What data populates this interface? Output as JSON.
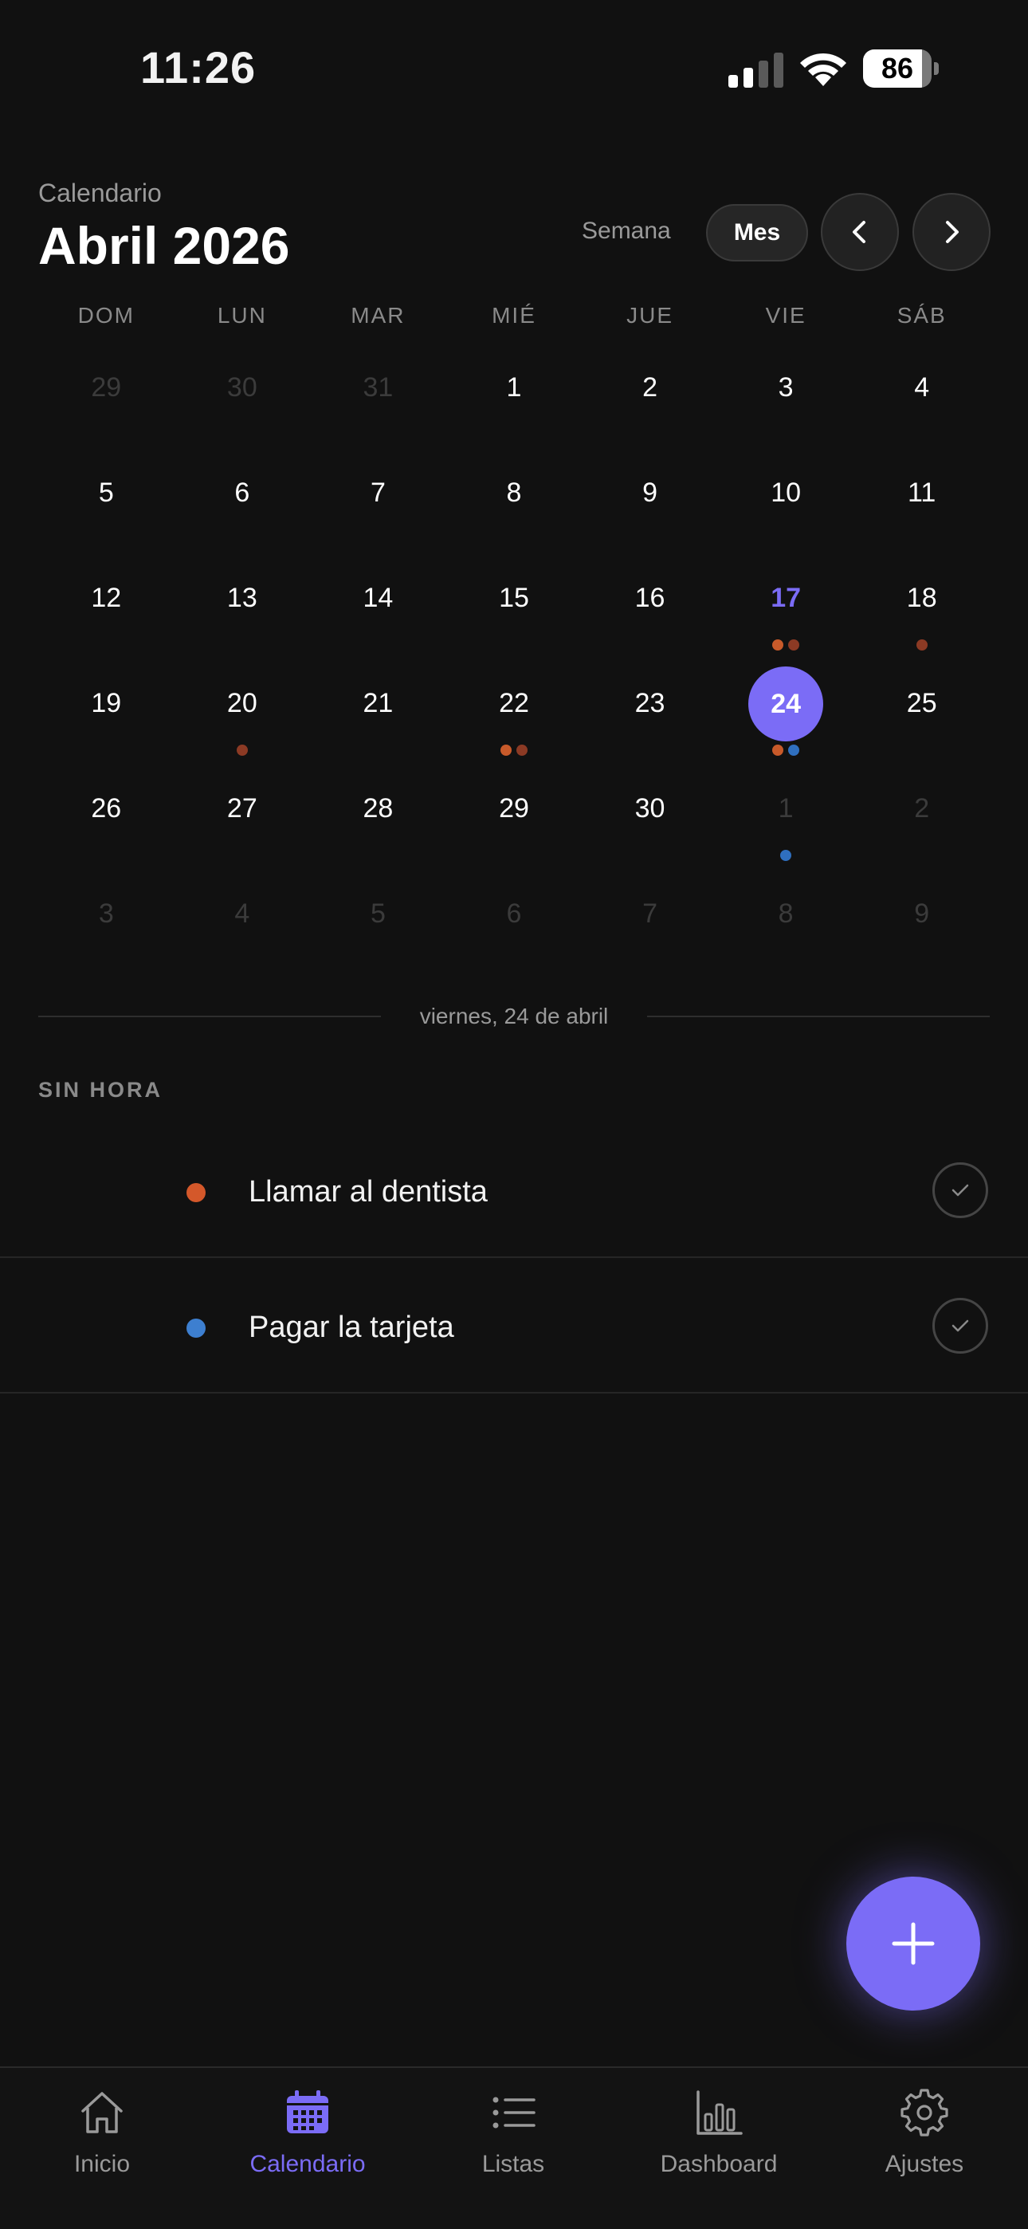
{
  "status_bar": {
    "time": "11:26",
    "battery_level": "86",
    "battery_fraction": 0.86
  },
  "header": {
    "subtitle": "Calendario",
    "title": "Abril 2026",
    "view_week_label": "Semana",
    "view_month_label": "Mes",
    "prev_icon": "chevron-left-icon",
    "next_icon": "chevron-right-icon"
  },
  "calendar": {
    "weekdays": [
      "DOM",
      "LUN",
      "MAR",
      "MIÉ",
      "JUE",
      "VIE",
      "SÁB"
    ],
    "weeks": [
      [
        {
          "n": "29",
          "other": true
        },
        {
          "n": "30",
          "other": true
        },
        {
          "n": "31",
          "other": true
        },
        {
          "n": "1"
        },
        {
          "n": "2"
        },
        {
          "n": "3"
        },
        {
          "n": "4"
        }
      ],
      [
        {
          "n": "5"
        },
        {
          "n": "6"
        },
        {
          "n": "7"
        },
        {
          "n": "8"
        },
        {
          "n": "9"
        },
        {
          "n": "10"
        },
        {
          "n": "11"
        }
      ],
      [
        {
          "n": "12"
        },
        {
          "n": "13"
        },
        {
          "n": "14"
        },
        {
          "n": "15"
        },
        {
          "n": "16"
        },
        {
          "n": "17",
          "today": true,
          "dots": [
            "#c85a2a",
            "#8c3a24"
          ]
        },
        {
          "n": "18",
          "dots": [
            "#8c3a24"
          ]
        }
      ],
      [
        {
          "n": "19"
        },
        {
          "n": "20",
          "dots": [
            "#8c3a24"
          ]
        },
        {
          "n": "21"
        },
        {
          "n": "22",
          "dots": [
            "#c85a2a",
            "#8c3a24"
          ]
        },
        {
          "n": "23"
        },
        {
          "n": "24",
          "selected": true,
          "dots": [
            "#c85a2a",
            "#2f6fbf"
          ]
        },
        {
          "n": "25"
        }
      ],
      [
        {
          "n": "26"
        },
        {
          "n": "27"
        },
        {
          "n": "28"
        },
        {
          "n": "29"
        },
        {
          "n": "30"
        },
        {
          "n": "1",
          "other": true,
          "dots": [
            "#2f6fbf"
          ]
        },
        {
          "n": "2",
          "other": true
        }
      ],
      [
        {
          "n": "3",
          "other": true
        },
        {
          "n": "4",
          "other": true
        },
        {
          "n": "5",
          "other": true
        },
        {
          "n": "6",
          "other": true
        },
        {
          "n": "7",
          "other": true
        },
        {
          "n": "8",
          "other": true
        },
        {
          "n": "9",
          "other": true
        }
      ]
    ]
  },
  "selected_day": {
    "label": "viernes, 24 de abril",
    "section_label": "SIN HORA",
    "tasks": [
      {
        "title": "Llamar al dentista",
        "color": "#d4582a"
      },
      {
        "title": "Pagar la tarjeta",
        "color": "#3d7fd0"
      }
    ]
  },
  "fab": {
    "icon": "plus-icon"
  },
  "tab_bar": {
    "tabs": [
      {
        "label": "Inicio",
        "icon": "home-icon",
        "active": false
      },
      {
        "label": "Calendario",
        "icon": "calendar-icon",
        "active": true
      },
      {
        "label": "Listas",
        "icon": "list-icon",
        "active": false
      },
      {
        "label": "Dashboard",
        "icon": "bar-chart-icon",
        "active": false
      },
      {
        "label": "Ajustes",
        "icon": "gear-icon",
        "active": false
      }
    ]
  },
  "colors": {
    "accent": "#7b6cf6",
    "background": "#111111",
    "orange": "#d4582a",
    "blue": "#3d7fd0"
  }
}
